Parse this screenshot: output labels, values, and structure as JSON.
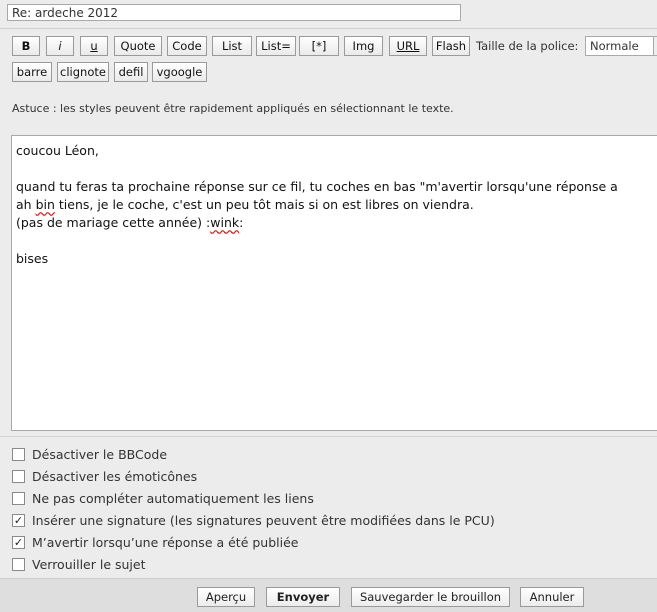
{
  "subject": {
    "value": "Re: ardeche 2012"
  },
  "toolbar": {
    "row1": [
      {
        "label": "B",
        "name": "bold-button"
      },
      {
        "label": "i",
        "name": "italic-button"
      },
      {
        "label": "u",
        "name": "underline-button"
      },
      {
        "label": "Quote",
        "name": "quote-button"
      },
      {
        "label": "Code",
        "name": "code-button"
      },
      {
        "label": "List",
        "name": "list-button"
      },
      {
        "label": "List=",
        "name": "ordered-list-button"
      },
      {
        "label": "[*]",
        "name": "list-item-button"
      },
      {
        "label": "Img",
        "name": "image-button"
      },
      {
        "label": "URL",
        "name": "url-button"
      },
      {
        "label": "Flash",
        "name": "flash-button"
      }
    ],
    "row2": [
      {
        "label": "barre",
        "name": "strike-button"
      },
      {
        "label": "clignote",
        "name": "blink-button"
      },
      {
        "label": "defil",
        "name": "marquee-button"
      },
      {
        "label": "vgoogle",
        "name": "vgoogle-button"
      }
    ],
    "font_size_label": "Taille de la police:",
    "font_size_value": "Normale"
  },
  "tip": "Astuce : les styles peuvent être rapidement appliqués en sélectionnant le texte.",
  "editor": {
    "line1": "coucou Léon,",
    "line2": "quand tu feras ta prochaine réponse sur ce fil, tu coches en bas \"m'avertir lorsqu'une réponse a",
    "line3_a": "ah ",
    "line3_b": "bin",
    "line3_c": " tiens, je le coche, c'est un peu tôt mais si on est libres on viendra.",
    "line4_a": "(pas de mariage cette année)  :",
    "line4_b": "wink",
    "line4_c": ":",
    "line5": "bises"
  },
  "options": [
    {
      "label": "Désactiver le BBCode",
      "checked": false
    },
    {
      "label": "Désactiver les émoticônes",
      "checked": false
    },
    {
      "label": "Ne pas compléter automatiquement les liens",
      "checked": false
    },
    {
      "label": "Insérer une signature (les signatures peuvent être modifiées dans le PCU)",
      "checked": true
    },
    {
      "label": "M’avertir lorsqu’une réponse a été publiée",
      "checked": true
    },
    {
      "label": "Verrouiller le sujet",
      "checked": false
    }
  ],
  "footer": {
    "preview": "Aperçu",
    "send": "Envoyer",
    "save_draft": "Sauvegarder le brouillon",
    "cancel": "Annuler"
  }
}
